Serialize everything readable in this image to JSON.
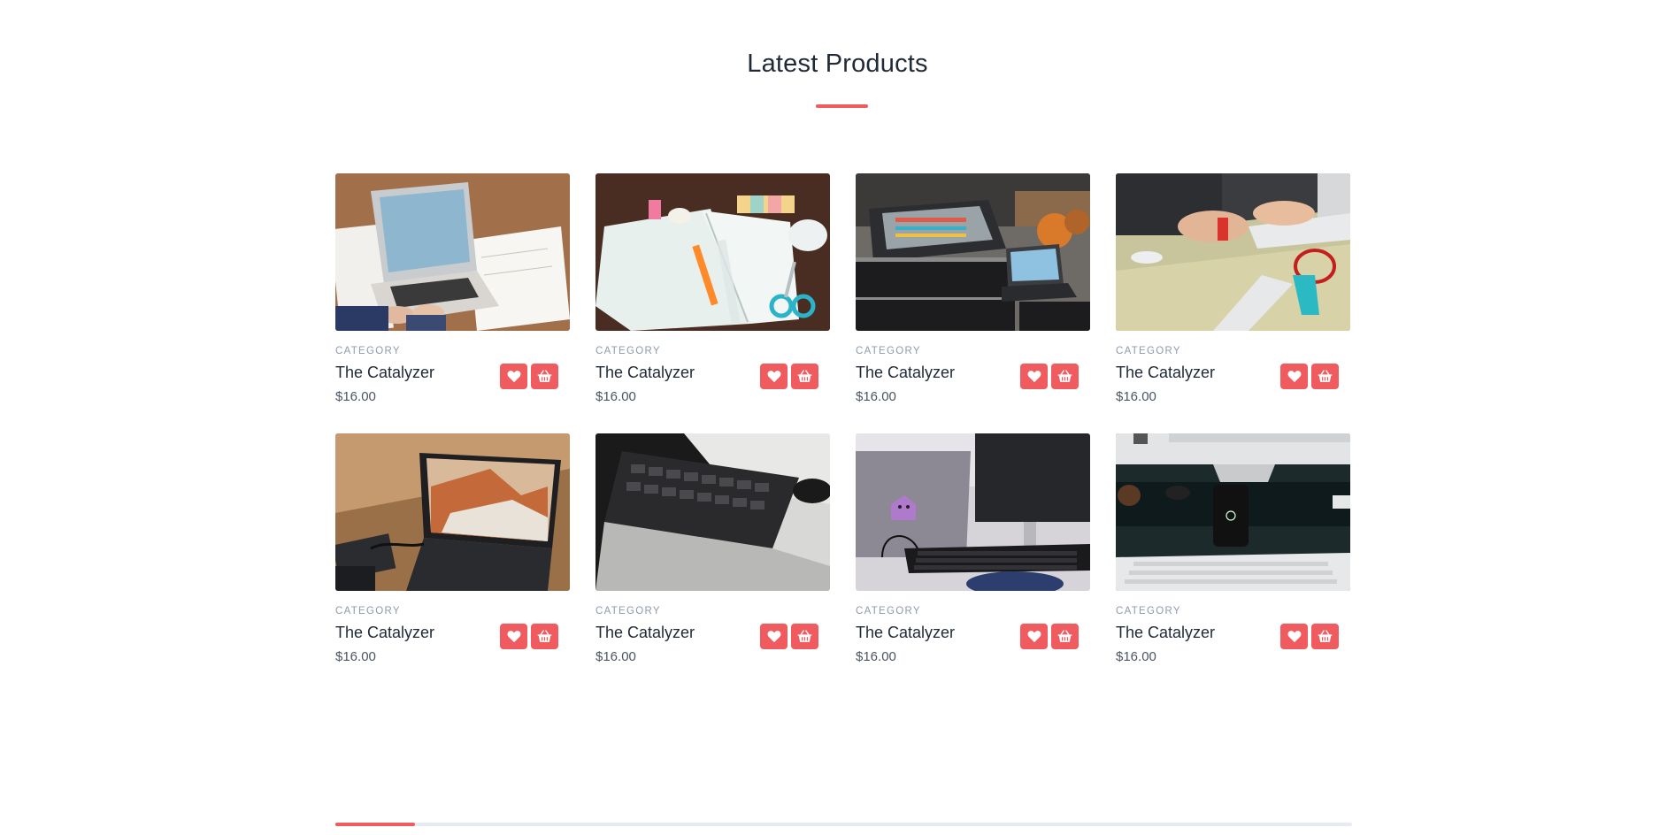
{
  "section": {
    "title": "Latest Products"
  },
  "colors": {
    "accent": "#ef5b5f",
    "title": "#1f2937",
    "category": "#8e9aac",
    "price": "#4b5563",
    "track": "#e6ebf3"
  },
  "products": [
    {
      "category": "CATEGORY",
      "name": "The Catalyzer",
      "price": "$16.00",
      "image": "laptop-on-wooden-desk-with-papers"
    },
    {
      "category": "CATEGORY",
      "name": "The Catalyzer",
      "price": "$16.00",
      "image": "notebook-with-pen-and-scissors"
    },
    {
      "category": "CATEGORY",
      "name": "The Catalyzer",
      "price": "$16.00",
      "image": "audio-mixing-console-and-laptop"
    },
    {
      "category": "CATEGORY",
      "name": "The Catalyzer",
      "price": "$16.00",
      "image": "hands-typing-on-keyboard-with-red-watch"
    },
    {
      "category": "CATEGORY",
      "name": "The Catalyzer",
      "price": "$16.00",
      "image": "laptop-showing-rock-landscape"
    },
    {
      "category": "CATEGORY",
      "name": "The Catalyzer",
      "price": "$16.00",
      "image": "laptop-keyboard-closeup"
    },
    {
      "category": "CATEGORY",
      "name": "The Catalyzer",
      "price": "$16.00",
      "image": "laptop-with-sticker-and-monitor"
    },
    {
      "category": "CATEGORY",
      "name": "The Catalyzer",
      "price": "$16.00",
      "image": "phone-on-desk-with-keyboard"
    }
  ],
  "icons": {
    "wishlist": "heart-icon",
    "cart": "basket-icon"
  },
  "carousel": {
    "progress_fraction": 0.078
  }
}
